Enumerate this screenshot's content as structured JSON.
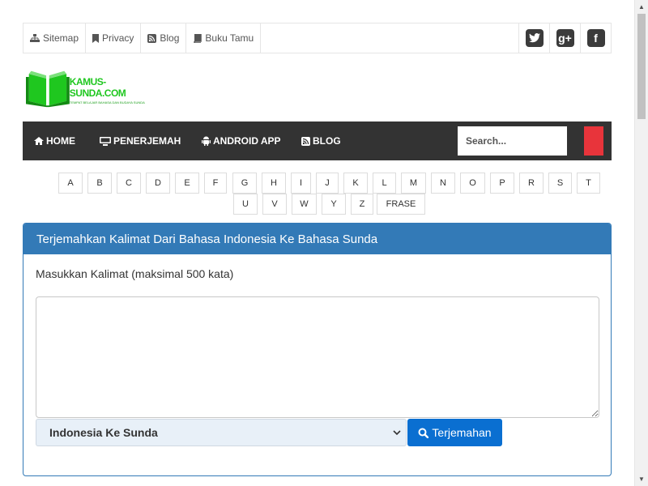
{
  "topbar": {
    "links": [
      {
        "label": "Sitemap",
        "icon": "sitemap-icon"
      },
      {
        "label": "Privacy",
        "icon": "bookmark-icon"
      },
      {
        "label": "Blog",
        "icon": "rss-icon"
      },
      {
        "label": "Buku Tamu",
        "icon": "book-icon"
      }
    ],
    "social": [
      {
        "icon": "twitter-icon"
      },
      {
        "icon": "google-plus-icon",
        "glyph": "g+"
      },
      {
        "icon": "facebook-icon",
        "glyph": "f"
      }
    ]
  },
  "logo": {
    "brand": "KAMUS-SUNDA.COM",
    "tagline": "TEMPAT BELAJAR BAHASA DAN BUDAYA SUNDA"
  },
  "nav": {
    "items": [
      {
        "label": "HOME",
        "icon": "home-icon"
      },
      {
        "label": "PENERJEMAH",
        "icon": "monitor-icon"
      },
      {
        "label": "ANDROID APP",
        "icon": "android-icon"
      },
      {
        "label": "BLOG",
        "icon": "rss-icon"
      }
    ],
    "search_placeholder": "Search..."
  },
  "alphabet": {
    "row1": [
      "A",
      "B",
      "C",
      "D",
      "E",
      "F",
      "G",
      "H",
      "I",
      "J",
      "K",
      "L",
      "M",
      "N",
      "O",
      "P",
      "R",
      "S",
      "T"
    ],
    "row2": [
      "U",
      "V",
      "W",
      "Y",
      "Z",
      "FRASE"
    ]
  },
  "panel": {
    "title": "Terjemahkan Kalimat Dari Bahasa Indonesia Ke Bahasa Sunda",
    "label": "Masukkan Kalimat (maksimal 500 kata)",
    "select_value": "Indonesia Ke Sunda",
    "button_label": "Terjemahan"
  },
  "colors": {
    "nav_bg": "#333333",
    "panel_primary": "#337ab7",
    "button_primary": "#0a6fd1",
    "search_button": "#e8343b",
    "logo_green": "#1fc71f"
  }
}
